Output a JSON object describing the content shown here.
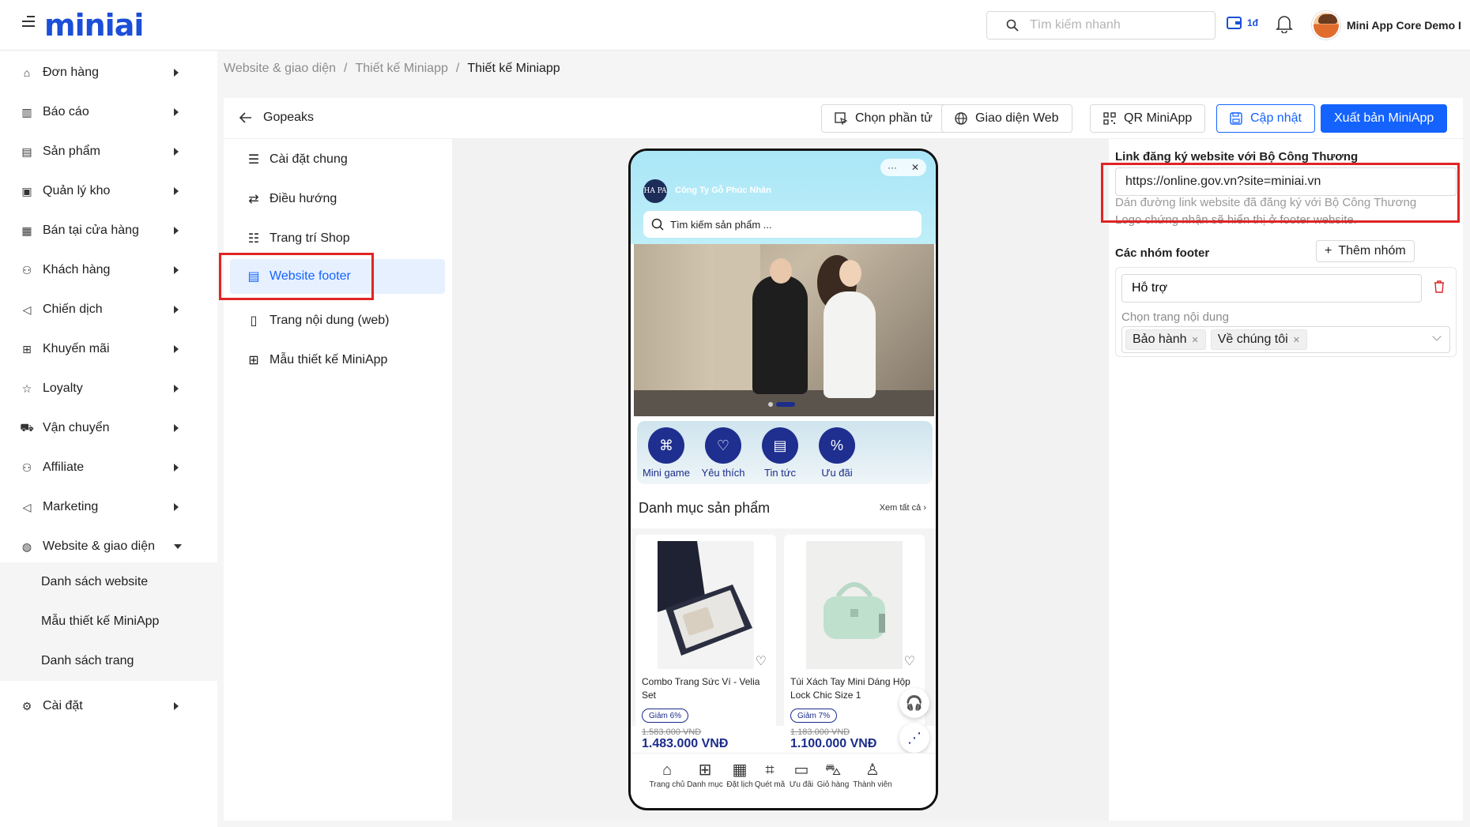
{
  "app": {
    "logo": "miniai",
    "search_placeholder": "Tìm kiếm nhanh",
    "wallet_label": "1đ",
    "user_name": "Mini App Core Demo I"
  },
  "sidebar": {
    "items": [
      {
        "label": "Đơn hàng",
        "icon": "bag-icon"
      },
      {
        "label": "Báo cáo",
        "icon": "chart-icon"
      },
      {
        "label": "Sản phẩm",
        "icon": "product-icon"
      },
      {
        "label": "Quản lý kho",
        "icon": "warehouse-icon"
      },
      {
        "label": "Bán tại cửa hàng",
        "icon": "store-icon"
      },
      {
        "label": "Khách hàng",
        "icon": "users-icon"
      },
      {
        "label": "Chiến dịch",
        "icon": "megaphone-icon"
      },
      {
        "label": "Khuyến mãi",
        "icon": "gift-icon"
      },
      {
        "label": "Loyalty",
        "icon": "star-icon"
      },
      {
        "label": "Vận chuyển",
        "icon": "truck-icon"
      },
      {
        "label": "Affiliate",
        "icon": "affiliate-icon"
      },
      {
        "label": "Marketing",
        "icon": "marketing-icon"
      },
      {
        "label": "Website & giao diện",
        "icon": "globe-icon"
      }
    ],
    "subitems": [
      "Danh sách website",
      "Mẫu thiết kế MiniApp",
      "Danh sách trang"
    ],
    "settings": "Cài đặt"
  },
  "breadcrumb": [
    "Website & giao diện",
    "Thiết kế Miniapp",
    "Thiết kế Miniapp"
  ],
  "header": {
    "back_label": "Gopeaks",
    "btn_select": "Chọn phần tử",
    "btn_web": "Giao diện Web",
    "btn_qr": "QR MiniApp",
    "btn_update": "Cập nhật",
    "btn_publish": "Xuất bản MiniApp"
  },
  "leftmenu": {
    "items": [
      "Cài đặt chung",
      "Điều hướng",
      "Trang trí Shop",
      "Website footer",
      "Trang nội dung (web)",
      "Mẫu thiết kế MiniApp"
    ],
    "active": "Website footer"
  },
  "phone": {
    "logo_text": "HA PA",
    "company": "Công Ty Gỗ Phúc Nhân",
    "search": "Tìm kiếm sản phẩm ...",
    "quick": [
      "Mini game",
      "Yêu thích",
      "Tin tức",
      "Ưu đãi"
    ],
    "section_title": "Danh mục sản phẩm",
    "see_all": "Xem tất cả",
    "products": [
      {
        "name": "Combo Trang Sức Ví - Velia Set",
        "badge": "Giảm 6%",
        "old": "1.583.000 VND",
        "price": "1.483.000 VNĐ"
      },
      {
        "name": "Túi Xách Tay Mini Dáng Hộp Lock Chic Size 1",
        "badge": "Giảm 7%",
        "old": "1.183.000 VND",
        "price": "1.100.000 VNĐ"
      }
    ],
    "tabs": [
      "Trang chủ",
      "Danh mục",
      "Đặt lịch",
      "Quét mã",
      "Ưu đãi",
      "Giỏ hàng",
      "Thành viên"
    ]
  },
  "config": {
    "link_label": "Link đăng ký website với Bộ Công Thương",
    "link_value": "https://online.gov.vn?site=miniai.vn",
    "help1": "Dán đường link website đã đăng ký với Bộ Công Thương",
    "help2": "Logo chứng nhận sẽ hiển thị ở footer website.",
    "groups_title": "Các nhóm footer",
    "add_group": "Thêm nhóm",
    "group_name": "Hỗ trợ",
    "pick_label": "Chọn trang nội dung",
    "tags": [
      "Bảo hành",
      "Về chúng tôi"
    ]
  },
  "colors": {
    "primary": "#1463ff",
    "highlight": "#e02424",
    "brand_navy": "#1c2d8a"
  }
}
